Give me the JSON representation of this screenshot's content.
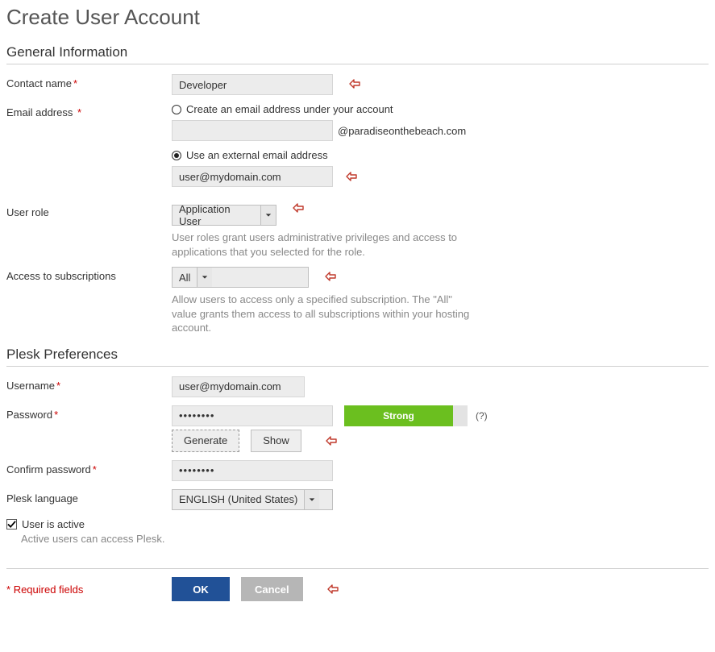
{
  "page_title": "Create User Account",
  "sections": {
    "general": "General Information",
    "plesk": "Plesk Preferences"
  },
  "general": {
    "contact_name_label": "Contact name",
    "contact_name_value": "Developer",
    "email_label": "Email address",
    "radio_create_label": "Create an email address under your account",
    "create_suffix": "@paradiseonthebeach.com",
    "radio_external_label": "Use an external email address",
    "external_value": "user@mydomain.com",
    "role_label": "User role",
    "role_value": "Application User",
    "role_help": "User roles grant users administrative privileges and access to applications that you selected for the role.",
    "subs_label": "Access to subscriptions",
    "subs_value": "All",
    "subs_help": "Allow users to access only a specified subscription. The \"All\" value grants them access to all subscriptions within your hosting account."
  },
  "plesk": {
    "username_label": "Username",
    "username_value": "user@mydomain.com",
    "password_label": "Password",
    "password_value": "••••••••",
    "strength_label": "Strong",
    "qmark": "(?)",
    "generate_label": "Generate",
    "show_label": "Show",
    "confirm_label": "Confirm password",
    "confirm_value": "••••••••",
    "lang_label": "Plesk language",
    "lang_value": "ENGLISH (United States)",
    "active_label": "User is active",
    "active_help": "Active users can access Plesk."
  },
  "footer": {
    "required_label": "Required fields",
    "ok": "OK",
    "cancel": "Cancel"
  }
}
